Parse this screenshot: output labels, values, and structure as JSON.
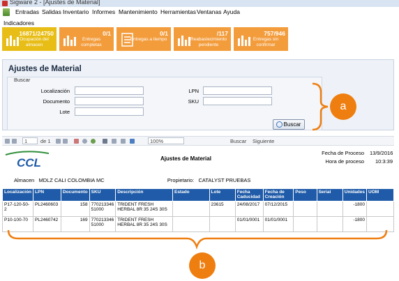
{
  "window": {
    "title": "Sigware 2 - [Ajustes de Material]"
  },
  "menu": [
    "Entradas",
    "Salidas",
    "Inventario",
    "Informes",
    "Mantenimiento",
    "Herramientas",
    "Ventanas",
    "Ayuda"
  ],
  "indicators": {
    "section_label": "Indicadores",
    "tiles": [
      {
        "value": "16871/24750",
        "label": "Ocupación del almacen",
        "icon": "bar-chart-icon"
      },
      {
        "value": "0/1",
        "label": "Entregas completas",
        "icon": "bar-chart-icon"
      },
      {
        "value": "0/1",
        "label": "Entregas a tiempo",
        "icon": "checklist-icon"
      },
      {
        "value": "/117",
        "label": "Reabastecimiento pendiente",
        "icon": "bar-chart-icon"
      },
      {
        "value": "757/946",
        "label": "Entregas sin confirmar",
        "icon": "bar-chart-icon"
      }
    ],
    "colors": {
      "first": "#e8bd16",
      "rest": "#f39c3c"
    }
  },
  "form": {
    "title": "Ajustes de Material",
    "group_label": "Buscar",
    "fields": {
      "localizacion": {
        "label": "Localización",
        "value": ""
      },
      "documento": {
        "label": "Documento",
        "value": ""
      },
      "lote": {
        "label": "Lote",
        "value": ""
      },
      "lpn": {
        "label": "LPN",
        "value": ""
      },
      "sku": {
        "label": "SKU",
        "value": ""
      }
    },
    "search_button": "Buscar"
  },
  "toolbar": {
    "page": "1",
    "of_pages": "de 1",
    "zoom": "100%",
    "find": "Buscar",
    "next": "Siguiente"
  },
  "report": {
    "logo_text": "CCL",
    "title": "Ajustes de Material",
    "process_date_label": "Fecha de Proceso",
    "process_date": "13/9/2016",
    "process_time_label": "Hora de proceso",
    "process_time": "10:3:39",
    "warehouse_label": "Almacen",
    "warehouse": "MDLZ CALI COLOMBIA MC",
    "owner_label": "Propietario:",
    "owner": "CATALYST PRUEBAS",
    "columns": [
      "Localización",
      "LPN",
      "Documento",
      "SKU",
      "Descripción",
      "Estado",
      "Lote",
      "Fecha Caducidad",
      "Fecha de Creación",
      "Peso",
      "Serial",
      "Unidades",
      "UOM"
    ],
    "rows": [
      [
        "P17-120-50-2",
        "PL2460603",
        "158",
        "770213346 51000",
        "TRIDENT FRESH HERBAL 8R 35 24S 30S",
        "",
        "23615",
        "24/08/2017",
        "07/12/2015",
        "",
        "",
        "-1800",
        ""
      ],
      [
        "P10-100-70",
        "PL2460742",
        "169",
        "770213346 51000",
        "TRIDENT FRESH HERBAL 8R 35 24S 30S",
        "",
        "",
        "01/01/0001",
        "01/01/0001",
        "",
        "",
        "-1800",
        ""
      ]
    ]
  },
  "annotations": {
    "a": "a",
    "b": "b",
    "color": "#ef7e10"
  }
}
